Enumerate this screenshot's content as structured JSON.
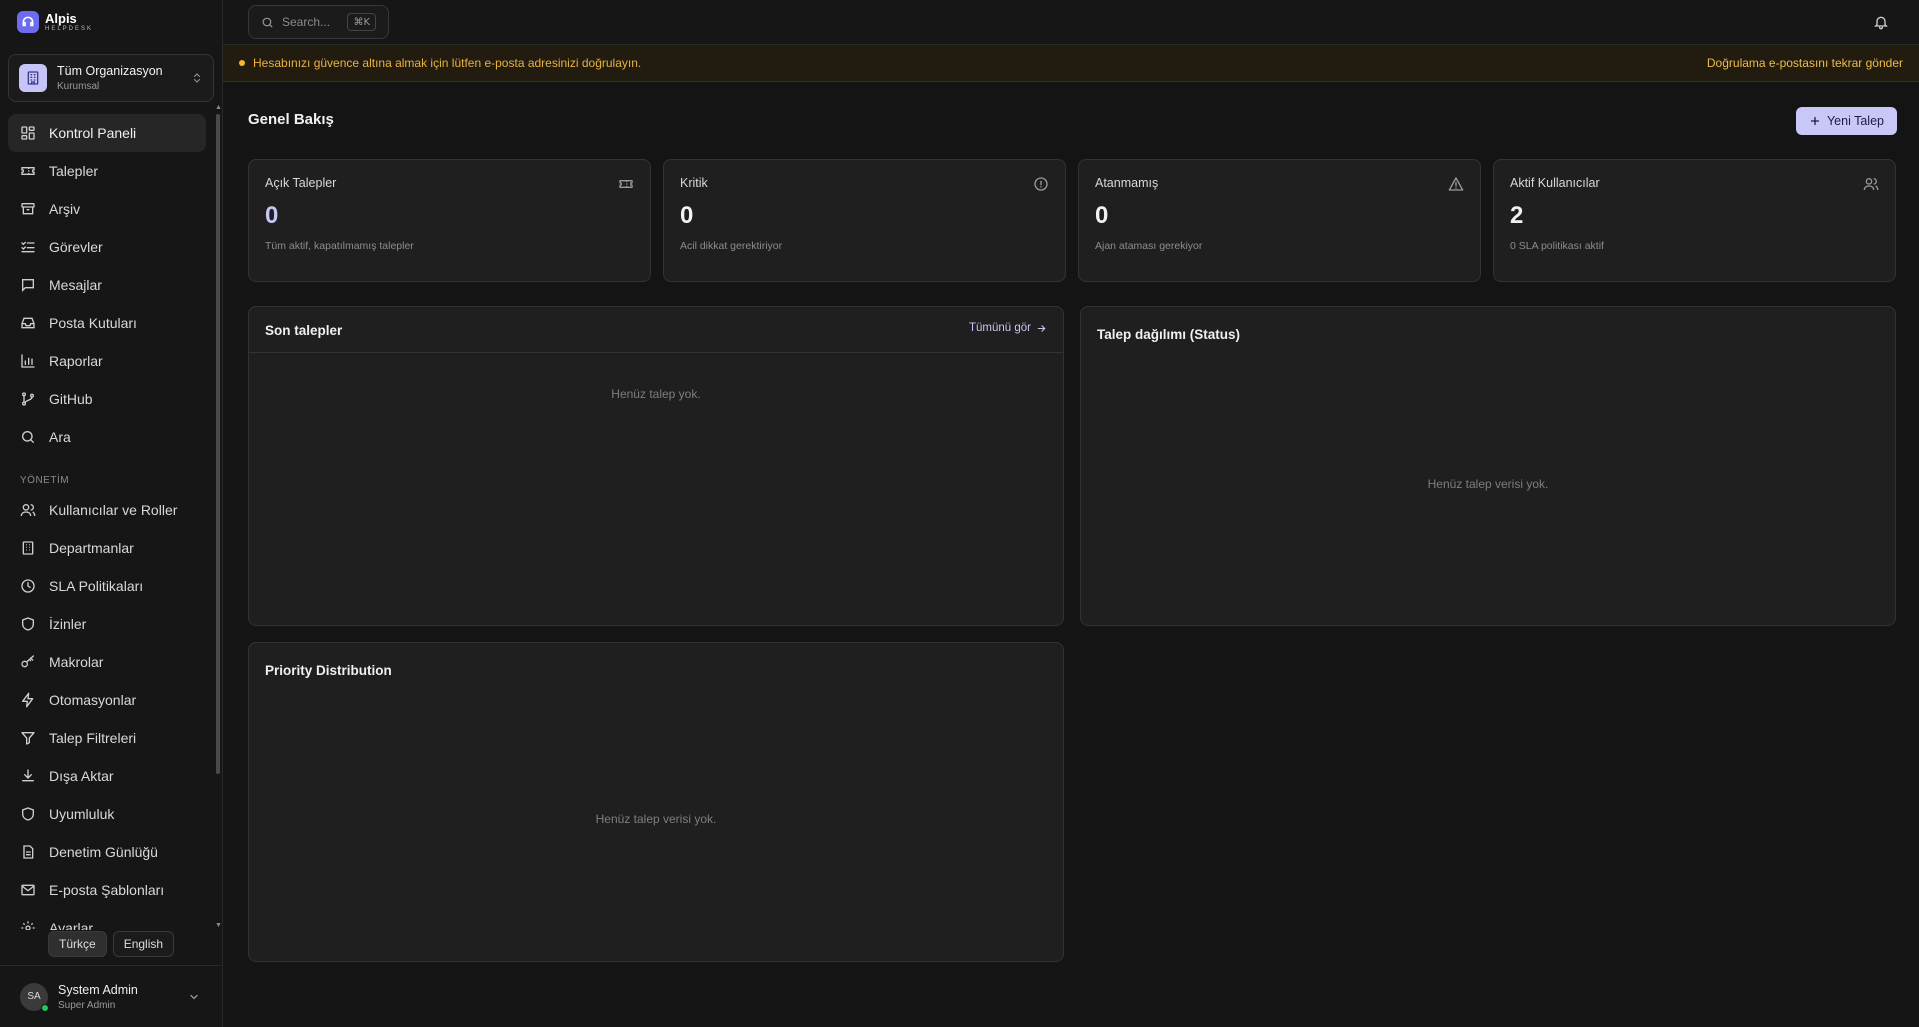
{
  "brand": {
    "name": "Alpis",
    "sub": "HELPDESK"
  },
  "org": {
    "name": "Tüm Organizasyon",
    "type": "Kurumsal"
  },
  "nav": {
    "items": [
      {
        "label": "Kontrol Paneli"
      },
      {
        "label": "Talepler"
      },
      {
        "label": "Arşiv"
      },
      {
        "label": "Görevler"
      },
      {
        "label": "Mesajlar"
      },
      {
        "label": "Posta Kutuları"
      },
      {
        "label": "Raporlar"
      },
      {
        "label": "GitHub"
      },
      {
        "label": "Ara"
      }
    ],
    "section_label": "YÖNETİM",
    "admin_items": [
      {
        "label": "Kullanıcılar ve Roller"
      },
      {
        "label": "Departmanlar"
      },
      {
        "label": "SLA Politikaları"
      },
      {
        "label": "İzinler"
      },
      {
        "label": "Makrolar"
      },
      {
        "label": "Otomasyonlar"
      },
      {
        "label": "Talep Filtreleri"
      },
      {
        "label": "Dışa Aktar"
      },
      {
        "label": "Uyumluluk"
      },
      {
        "label": "Denetim Günlüğü"
      },
      {
        "label": "E-posta Şablonları"
      },
      {
        "label": "Ayarlar"
      }
    ]
  },
  "lang": {
    "tr": "Türkçe",
    "en": "English"
  },
  "user": {
    "initials": "SA",
    "name": "System Admin",
    "role": "Super Admin"
  },
  "search": {
    "placeholder": "Search...",
    "shortcut": "⌘K"
  },
  "banner": {
    "message": "Hesabınızı güvence altına almak için lütfen e-posta adresinizi doğrulayın.",
    "action": "Doğrulama e-postasını tekrar gönder"
  },
  "page": {
    "title": "Genel Bakış",
    "new_button": "Yeni Talep"
  },
  "stats": [
    {
      "title": "Açık Talepler",
      "value": "0",
      "desc": "Tüm aktif, kapatılmamış talepler",
      "icon": "ticket-icon"
    },
    {
      "title": "Kritik",
      "value": "0",
      "desc": "Acil dikkat gerektiriyor",
      "icon": "alert-circle-icon"
    },
    {
      "title": "Atanmamış",
      "value": "0",
      "desc": "Ajan ataması gerekiyor",
      "icon": "warning-triangle-icon"
    },
    {
      "title": "Aktif Kullanıcılar",
      "value": "2",
      "desc": "0 SLA politikası aktif",
      "icon": "users-icon"
    }
  ],
  "recent": {
    "title": "Son talepler",
    "link": "Tümünü gör",
    "empty": "Henüz talep yok."
  },
  "status_dist": {
    "title": "Talep dağılımı (Status)",
    "empty": "Henüz talep verisi yok."
  },
  "priority_dist": {
    "title": "Priority Distribution",
    "empty": "Henüz talep verisi yok."
  },
  "colors": {
    "accent": "#c7c5f7",
    "warning": "#e8b23c",
    "online": "#22c55e"
  }
}
